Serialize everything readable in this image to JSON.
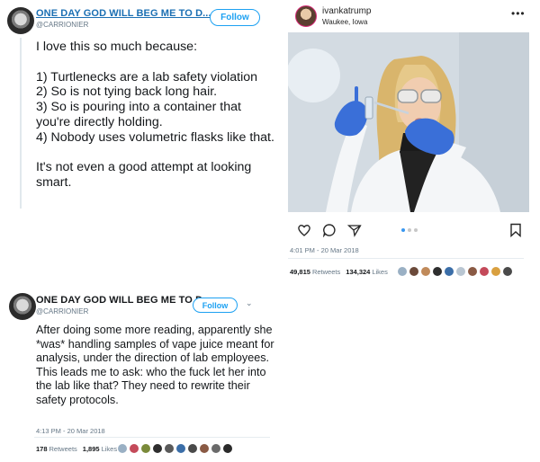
{
  "tweet1": {
    "display_name": "ONE DAY GOD WILL BEG ME TO D...",
    "handle": "@CARRIONIER",
    "follow_label": "Follow",
    "text": "I love this so much because:\n\n1) Turtlenecks are a lab safety violation\n2) So is not tying back long hair.\n3) So is pouring into a container that you're directly holding.\n4) Nobody uses volumetric flasks like that.\n\nIt's not even a good attempt at looking smart."
  },
  "instagram": {
    "username": "ivankatrump",
    "location": "Waukee, Iowa",
    "more_label": "•••",
    "carousel_dots": 3,
    "active_dot": 0
  },
  "tweet1_footer": {
    "timestamp": "4:01 PM - 20 Mar 2018",
    "retweets_count": "49,815",
    "retweets_label": "Retweets",
    "likes_count": "134,324",
    "likes_label": "Likes"
  },
  "tweet2": {
    "display_name": "ONE DAY GOD WILL BEG ME TO D...",
    "handle": "@CARRIONIER",
    "follow_label": "Follow",
    "text": "After doing some more reading, apparently she *was* handling samples of vape juice meant for analysis, under the direction of lab employees. This leads me to ask: who the fuck let her into the lab like that? They need to rewrite their safety protocols.",
    "timestamp": "4:13 PM - 20 Mar 2018",
    "retweets_count": "178",
    "retweets_label": "Retweets",
    "likes_count": "1,895",
    "likes_label": "Likes"
  },
  "colors": {
    "twitter_blue": "#1da1f2",
    "link_blue": "#1b6fb3",
    "muted_text": "#657786",
    "instagram_active_dot": "#3897f0",
    "glove_blue": "#3a6fd8"
  }
}
